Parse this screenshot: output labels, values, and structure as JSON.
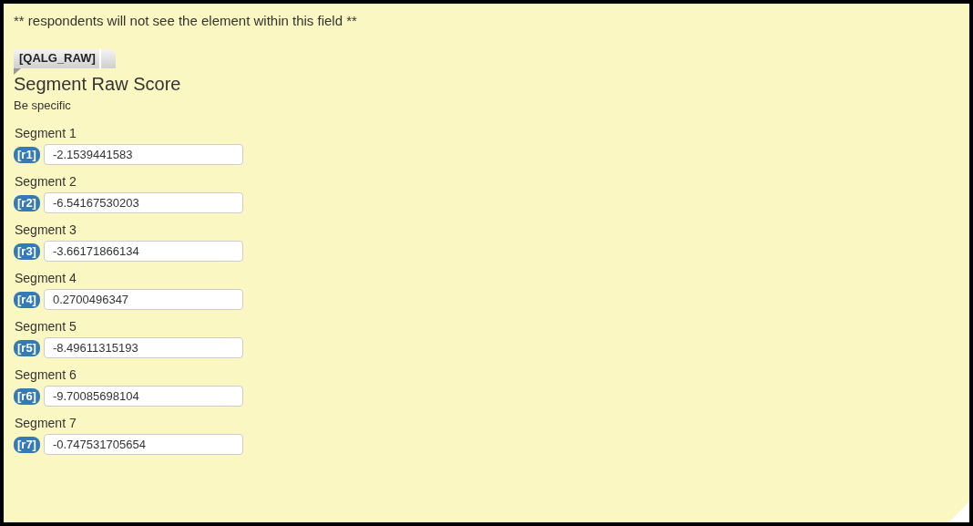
{
  "note": "** respondents will not see the element within this field **",
  "question": {
    "tag": "[QALG_RAW]",
    "title": "Segment Raw Score",
    "instruction": "Be specific"
  },
  "rows": [
    {
      "label": "Segment 1",
      "code": "[r1]",
      "value": "-2.1539441583"
    },
    {
      "label": "Segment 2",
      "code": "[r2]",
      "value": "-6.54167530203"
    },
    {
      "label": "Segment 3",
      "code": "[r3]",
      "value": "-3.66171866134"
    },
    {
      "label": "Segment 4",
      "code": "[r4]",
      "value": "0.2700496347"
    },
    {
      "label": "Segment 5",
      "code": "[r5]",
      "value": "-8.49611315193"
    },
    {
      "label": "Segment 6",
      "code": "[r6]",
      "value": "-9.70085698104"
    },
    {
      "label": "Segment 7",
      "code": "[r7]",
      "value": "-0.747531705654"
    }
  ]
}
